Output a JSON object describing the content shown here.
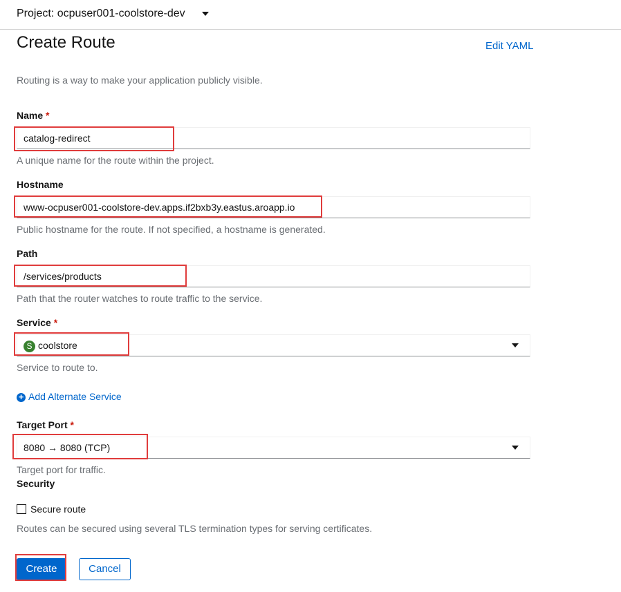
{
  "project": {
    "label": "Project: ocpuser001-coolstore-dev"
  },
  "page": {
    "title": "Create Route",
    "edit_yaml": "Edit YAML",
    "description": "Routing is a way to make your application publicly visible."
  },
  "form": {
    "name": {
      "label": "Name",
      "required": "*",
      "value": "catalog-redirect",
      "help": "A unique name for the route within the project."
    },
    "hostname": {
      "label": "Hostname",
      "value": "www-ocpuser001-coolstore-dev.apps.if2bxb3y.eastus.aroapp.io",
      "help": "Public hostname for the route. If not specified, a hostname is generated."
    },
    "path": {
      "label": "Path",
      "value": "/services/products",
      "help": "Path that the router watches to route traffic to the service."
    },
    "service": {
      "label": "Service",
      "required": "*",
      "badge": "S",
      "value": "coolstore",
      "help": "Service to route to."
    },
    "add_service": {
      "icon": "plus-circle-icon",
      "label": "Add Alternate Service"
    },
    "target_port": {
      "label": "Target Port",
      "required": "*",
      "value": "8080 → 8080 (TCP)",
      "help": "Target port for traffic."
    },
    "security": {
      "label": "Security",
      "checkbox_label": "Secure route",
      "checked": false,
      "help": "Routes can be secured using several TLS termination types for serving certificates."
    }
  },
  "buttons": {
    "create": "Create",
    "cancel": "Cancel"
  },
  "colors": {
    "highlight": "#e03c3c",
    "link": "#0066cc",
    "primary": "#0066cc",
    "service_badge": "#38812f",
    "required": "#c9190b"
  }
}
